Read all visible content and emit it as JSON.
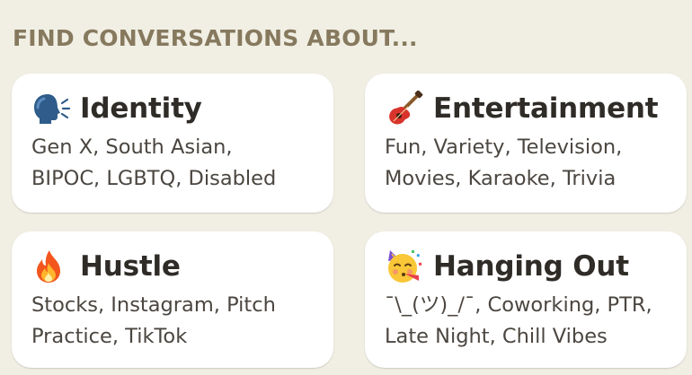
{
  "heading": "FIND CONVERSATIONS ABOUT...",
  "cards": [
    {
      "icon": "speaking-head-icon",
      "title": "Identity",
      "lines": [
        "Gen X, South Asian,",
        "BIPOC, LGBTQ, Disabled"
      ]
    },
    {
      "icon": "guitar-icon",
      "title": "Entertainment",
      "lines": [
        "Fun, Variety, Television,",
        "Movies, Karaoke, Trivia"
      ]
    },
    {
      "icon": "fire-icon",
      "title": "Hustle",
      "lines": [
        "Stocks, Instagram, Pitch",
        "Practice, TikTok"
      ]
    },
    {
      "icon": "partying-face-icon",
      "title": "Hanging Out",
      "lines": [
        "¯\\_(ツ)_/¯, Coworking, PTR,",
        "Late Night, Chill Vibes"
      ]
    }
  ],
  "colors": {
    "background": "#f1efe4",
    "heading": "#86795e",
    "card": "#ffffff",
    "title": "#2f2c28",
    "text": "#4b4640"
  }
}
